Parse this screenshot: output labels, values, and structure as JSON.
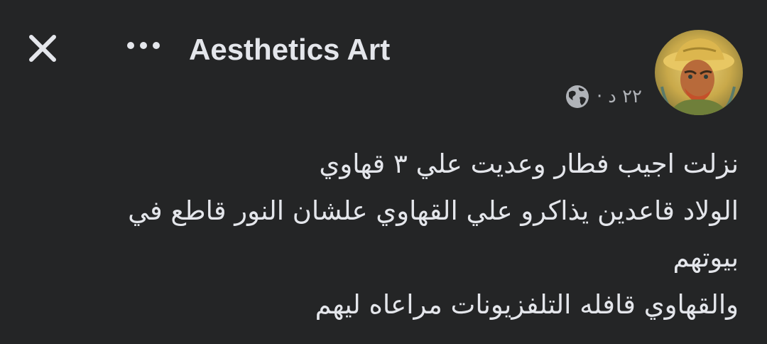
{
  "header": {
    "page_name": "Aesthetics Art",
    "close_icon": "close-icon",
    "more_icon": "more-options-icon"
  },
  "post_meta": {
    "time": "٢٢ د",
    "separator": "·",
    "privacy_icon": "globe-icon"
  },
  "post": {
    "lines": [
      "نزلت اجيب فطار وعديت علي ٣ قهاوي",
      "الولاد قاعدين يذاكرو علي القهاوي علشان النور قاطع في",
      "بيوتهم",
      "والقهاوي قافله التلفزيونات مراعاه ليهم"
    ]
  },
  "colors": {
    "background": "#242526",
    "primary_text": "#e4e6eb",
    "secondary_text": "#b0b3b8"
  }
}
